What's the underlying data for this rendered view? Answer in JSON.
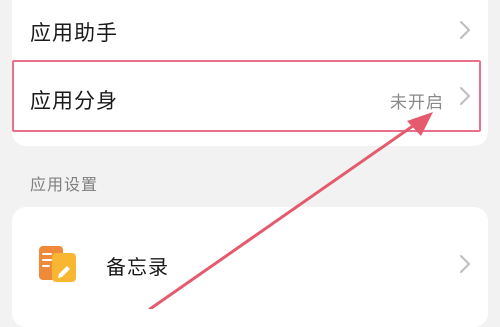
{
  "rows": {
    "app_assistant": {
      "label": "应用助手"
    },
    "app_clone": {
      "label": "应用分身",
      "status": "未开启"
    }
  },
  "section": {
    "title": "应用设置"
  },
  "apps": [
    {
      "label": "备忘录",
      "icon": "memo-app-icon"
    }
  ],
  "colors": {
    "background": "#f2f2f2",
    "card": "#ffffff",
    "highlight": "#e8708c",
    "arrow": "#e65a6e",
    "memo_icon_back": "#f08a3a",
    "memo_icon_front": "#f7b733"
  }
}
